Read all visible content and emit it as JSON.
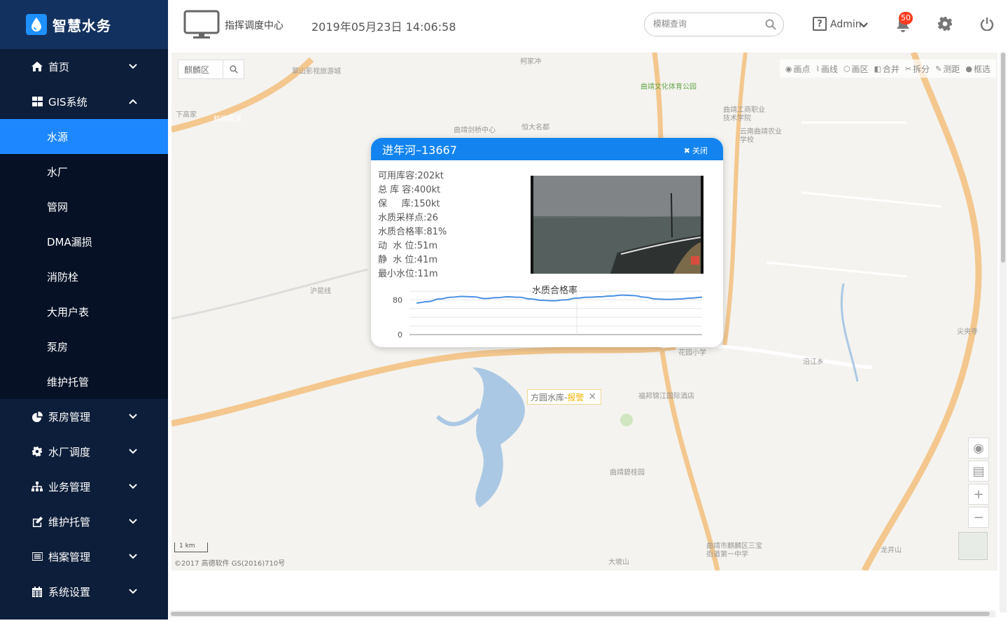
{
  "brand": {
    "name": "智慧水务"
  },
  "sidebar": {
    "menu": [
      {
        "label": "首页",
        "icon": "home-icon",
        "expanded": false
      },
      {
        "label": "GIS系统",
        "icon": "grid-icon",
        "expanded": true,
        "children": [
          "水源",
          "水厂",
          "管网",
          "DMA漏损",
          "消防栓",
          "大用户表",
          "泵房",
          "维护托管"
        ],
        "active_child": "水源"
      },
      {
        "label": "泵房管理",
        "icon": "pie-chart-icon",
        "expanded": false
      },
      {
        "label": "水厂调度",
        "icon": "gear-icon",
        "expanded": false
      },
      {
        "label": "业务管理",
        "icon": "sitemap-icon",
        "expanded": false
      },
      {
        "label": "维护托管",
        "icon": "edit-icon",
        "expanded": false
      },
      {
        "label": "档案管理",
        "icon": "list-icon",
        "expanded": false
      },
      {
        "label": "系统设置",
        "icon": "calendar-icon",
        "expanded": false
      }
    ]
  },
  "header": {
    "title": "指挥调度中心",
    "datetime": "2019年05月23日 14:06:58",
    "search_placeholder": "模糊查询",
    "user": "Admin",
    "notification_count": "50"
  },
  "map": {
    "district": "麒麟区",
    "tools": [
      "画点",
      "画线",
      "画区",
      "合并",
      "拆分",
      "测距",
      "框选"
    ],
    "scale": "1 km",
    "copyright": "©2017 高德软件 GS(2016)710号",
    "marker": {
      "name": "方圆水库-",
      "status": "报警"
    },
    "labels": [
      {
        "text": "翠山影视旅游城"
      },
      {
        "text": "柯家冲"
      },
      {
        "text": "曲靖文化体育公园"
      },
      {
        "text": "曲靖工商职业技术学院"
      },
      {
        "text": "云南曲靖农业学校"
      },
      {
        "text": "曲靖剑桥中心"
      },
      {
        "text": "恒大名都"
      },
      {
        "text": "杭瑞高速"
      },
      {
        "text": "下高家"
      },
      {
        "text": "沪昆线"
      },
      {
        "text": "福邦锦江国际酒店"
      },
      {
        "text": "曲靖碧桂园"
      },
      {
        "text": "尖夹寺"
      },
      {
        "text": "龙井山"
      },
      {
        "text": "大坡山"
      },
      {
        "text": "曲靖市麒麟区三宝街道第一中学"
      },
      {
        "text": "花园小学"
      },
      {
        "text": "沿江乡"
      }
    ]
  },
  "popup": {
    "title": "进年河–13667",
    "close_label": "关闭",
    "info": [
      {
        "label": "可用库容:",
        "value": "202kt"
      },
      {
        "label": "总 库 容:",
        "value": "400kt"
      },
      {
        "label": "保     库:",
        "value": "150kt"
      },
      {
        "label": "水质采样点:",
        "value": "26"
      },
      {
        "label": "水质合格率:",
        "value": "81%"
      },
      {
        "label": "动  水 位:",
        "value": "51m"
      },
      {
        "label": "静  水 位:",
        "value": "41m"
      },
      {
        "label": "最小水位:",
        "value": "11m"
      }
    ],
    "chart_title": "水质合格率"
  },
  "chart_data": {
    "type": "line",
    "title": "水质合格率",
    "y_ticks": [
      "80",
      "0"
    ],
    "ylim": [
      0,
      100
    ],
    "series": [
      {
        "values": [
          73,
          76,
          82,
          86,
          88,
          87,
          83,
          85,
          87,
          86,
          82,
          79,
          78,
          80,
          84,
          86,
          87,
          89,
          91,
          90,
          86,
          82,
          81,
          82,
          84,
          86
        ]
      }
    ],
    "grid": true
  }
}
